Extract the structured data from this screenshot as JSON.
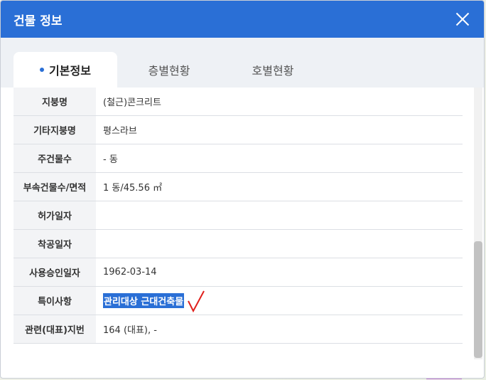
{
  "dialog": {
    "title": "건물 정보",
    "close_icon": "close-icon"
  },
  "tabs": [
    {
      "label": "기본정보",
      "active": true
    },
    {
      "label": "층별현황",
      "active": false
    },
    {
      "label": "호별현황",
      "active": false
    }
  ],
  "rows": [
    {
      "label": "지붕명",
      "value": "(철근)콘크리트"
    },
    {
      "label": "기타지붕명",
      "value": "평스라브"
    },
    {
      "label": "주건물수",
      "value": "- 동"
    },
    {
      "label": "부속건물수/면적",
      "value": "1 동/45.56 ㎡"
    },
    {
      "label": "허가일자",
      "value": ""
    },
    {
      "label": "착공일자",
      "value": ""
    },
    {
      "label": "사용승인일자",
      "value": "1962-03-14"
    },
    {
      "label": "특이사항",
      "value": "관리대상 근대건축물"
    },
    {
      "label": "관련(대표)지번",
      "value": "164 (대표), -"
    }
  ],
  "colors": {
    "header": "#2a6fd6",
    "highlight": "#2a6fd6",
    "checkmark": "#e0201c"
  }
}
